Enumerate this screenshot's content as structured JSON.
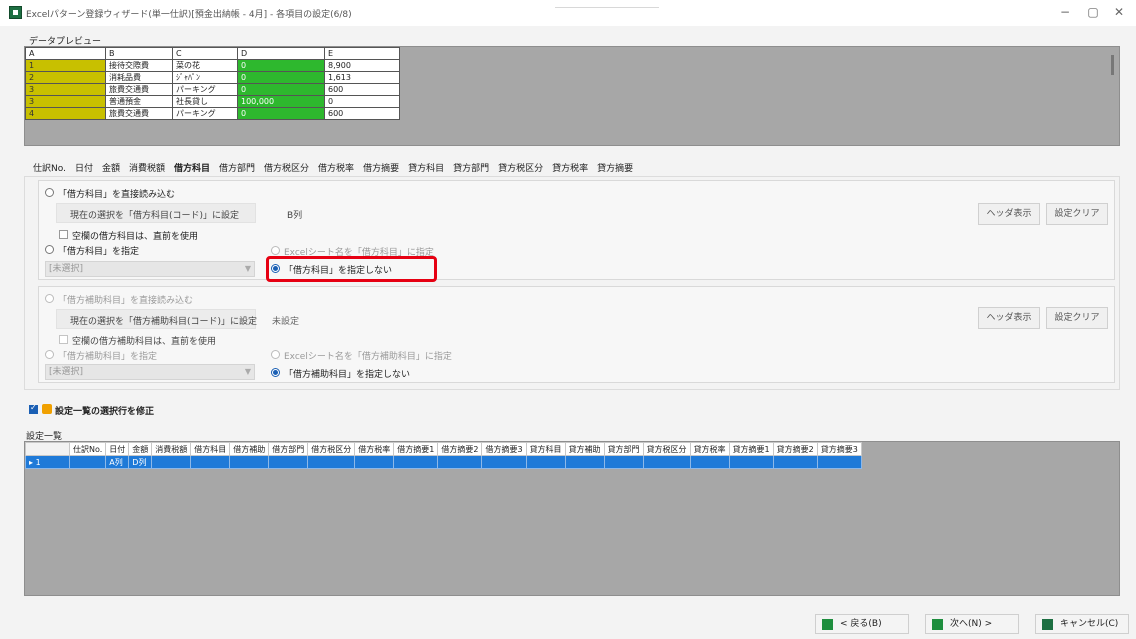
{
  "window": {
    "title": "Excelパターン登録ウィザード(単一仕訳)[預金出納帳 - 4月] - 各項目の設定(6/8)",
    "minimize": "−",
    "maximize": "▢",
    "close": "✕"
  },
  "preview": {
    "label": "データプレビュー",
    "columns": [
      "A",
      "B",
      "C",
      "D",
      "E"
    ],
    "rows": [
      [
        "1",
        "接待交際費",
        "菜の花",
        "0",
        "8,900"
      ],
      [
        "2",
        "消耗品費",
        "ｼﾞｬﾊﾟﾝ",
        "0",
        "1,613"
      ],
      [
        "3",
        "旅費交通費",
        "パーキング",
        "0",
        "600"
      ],
      [
        "3",
        "普通預金",
        "社長貸し",
        "100,000",
        "0"
      ],
      [
        "4",
        "旅費交通費",
        "パーキング",
        "0",
        "600"
      ]
    ]
  },
  "tabs": [
    "仕訳No.",
    "日付",
    "金額",
    "消費税額",
    "借方科目",
    "借方部門",
    "借方税区分",
    "借方税率",
    "借方摘要",
    "貸方科目",
    "貸方部門",
    "貸方税区分",
    "貸方税率",
    "貸方摘要"
  ],
  "active_tab": "借方科目",
  "section1": {
    "direct_read": "「借方科目」を直接読み込む",
    "current_selection": "現在の選択を「借方科目(コード)」に設定",
    "column_value": "B列",
    "blank_use_previous": "空欄の借方科目は、直前を使用",
    "specify": "「借方科目」を指定",
    "combo_value": "[未選択]",
    "sheet_name_option": "Excelシート名を「借方科目」に指定",
    "not_specify": "「借方科目」を指定しない",
    "header_btn": "ヘッダ表示",
    "clear_btn": "設定クリア"
  },
  "section2": {
    "direct_read": "「借方補助科目」を直接読み込む",
    "current_selection": "現在の選択を「借方補助科目(コード)」に設定",
    "column_value": "未設定",
    "blank_use_previous": "空欄の借方補助科目は、直前を使用",
    "specify": "「借方補助科目」を指定",
    "combo_value": "[未選択]",
    "sheet_name_option": "Excelシート名を「借方補助科目」に指定",
    "not_specify": "「借方補助科目」を指定しない",
    "header_btn": "ヘッダ表示",
    "clear_btn": "設定クリア"
  },
  "modify_selected_row": "設定一覧の選択行を修正",
  "settings_list": {
    "label": "設定一覧",
    "headers": [
      "仕訳No.",
      "日付",
      "金額",
      "消費税額",
      "借方科目",
      "借方補助",
      "借方部門",
      "借方税区分",
      "借方税率",
      "借方摘要1",
      "借方摘要2",
      "借方摘要3",
      "貸方科目",
      "貸方補助",
      "貸方部門",
      "貸方税区分",
      "貸方税率",
      "貸方摘要1",
      "貸方摘要2",
      "貸方摘要3"
    ],
    "rows": [
      {
        "no": "1",
        "cells": [
          "",
          "A列",
          "D列",
          "",
          "",
          "",
          "",
          "",
          "",
          "",
          "",
          "",
          "",
          "",
          "",
          "",
          "",
          "",
          "",
          ""
        ]
      }
    ]
  },
  "footer": {
    "back": "< 戻る(B)",
    "next": "次へ(N) >",
    "cancel": "キャンセル(C)"
  }
}
